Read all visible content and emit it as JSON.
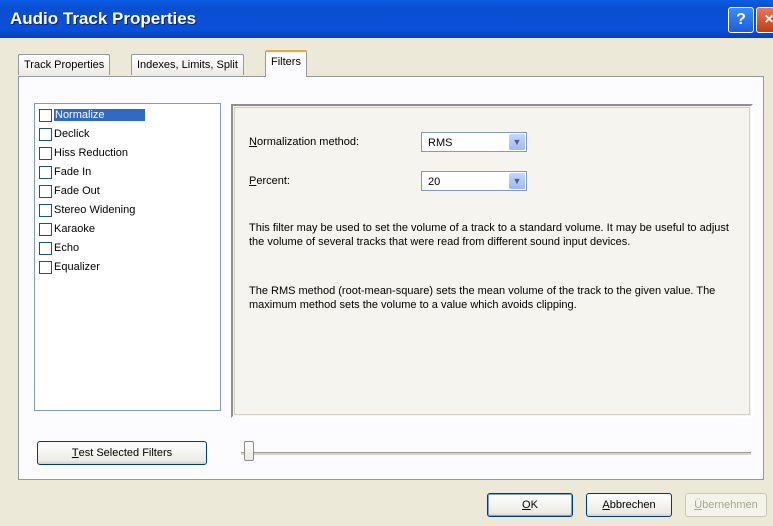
{
  "window": {
    "title": "Audio Track Properties",
    "help_glyph": "?",
    "close_glyph": "×"
  },
  "tabs": [
    {
      "label": "Track Properties",
      "active": false
    },
    {
      "label": "Indexes, Limits, Split",
      "active": false
    },
    {
      "label": "Filters",
      "active": true
    }
  ],
  "filters": [
    {
      "label": "Normalize",
      "checked": false,
      "selected": true
    },
    {
      "label": "Declick",
      "checked": false,
      "selected": false
    },
    {
      "label": "Hiss Reduction",
      "checked": false,
      "selected": false
    },
    {
      "label": "Fade In",
      "checked": false,
      "selected": false
    },
    {
      "label": "Fade Out",
      "checked": false,
      "selected": false
    },
    {
      "label": "Stereo Widening",
      "checked": false,
      "selected": false
    },
    {
      "label": "Karaoke",
      "checked": false,
      "selected": false
    },
    {
      "label": "Echo",
      "checked": false,
      "selected": false
    },
    {
      "label": "Equalizer",
      "checked": false,
      "selected": false
    }
  ],
  "settings": {
    "method_label_first": "N",
    "method_label_rest": "ormalization method:",
    "method_value": "RMS",
    "percent_label_first": "P",
    "percent_label_rest": "ercent:",
    "percent_value": "20",
    "description_1": "This filter may be used to set the volume of a track to a standard volume. It may be useful to adjust the volume of several tracks that were read from different sound input devices.",
    "description_2": "The RMS method (root-mean-square) sets the mean volume of the track to the given value. The maximum method sets the volume to a value which avoids clipping."
  },
  "test_button": {
    "first": "T",
    "rest": "est Selected Filters"
  },
  "slider": {
    "value": 0
  },
  "buttons": {
    "ok_first": "O",
    "ok_rest": "K",
    "cancel_first": "A",
    "cancel_rest": "bbrechen",
    "apply_first": "Ü",
    "apply_rest": "bernehmen"
  },
  "colors": {
    "titlebar": "#0a4fd0",
    "selection": "#316ac5",
    "active_tab_accent": "#f3a534"
  }
}
